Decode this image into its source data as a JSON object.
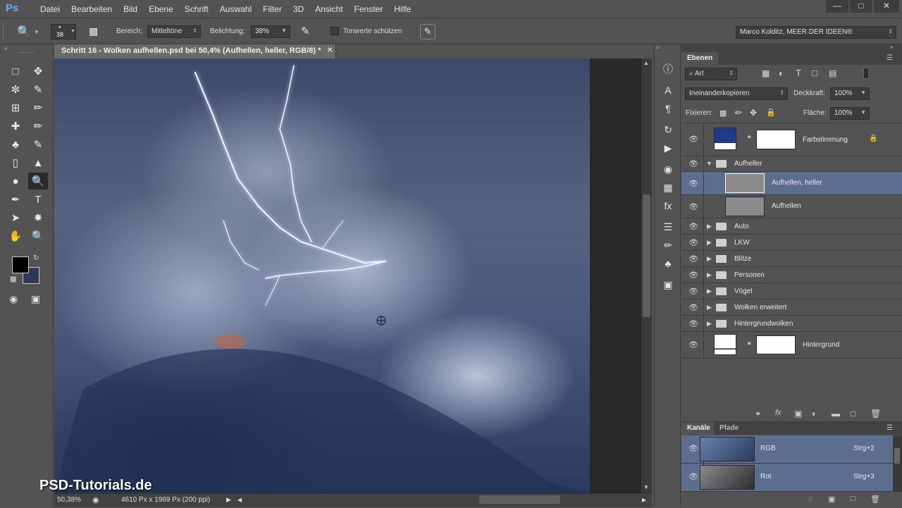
{
  "menubar": {
    "app_logo": "Ps",
    "items": [
      "Datei",
      "Bearbeiten",
      "Bild",
      "Ebene",
      "Schrift",
      "Auswahl",
      "Filter",
      "3D",
      "Ansicht",
      "Fenster",
      "Hilfe"
    ]
  },
  "optionsbar": {
    "brush_size": "38",
    "range_label": "Bereich:",
    "range_value": "Mitteltöne",
    "exposure_label": "Belichtung:",
    "exposure_value": "38%",
    "protect_tones_label": "Tonwerte schützen",
    "workspace": "Marco Kolditz, MEER DER IDEEN®"
  },
  "document": {
    "tab_title": "Schritt 16 - Wolken aufhellen.psd bei 50,4% (Aufhellen, heller, RGB/8) *",
    "zoom": "50,38%",
    "doc_info": "4610 Px x 1969 Px (200 ppi)",
    "watermark": "PSD-Tutorials.de"
  },
  "layers": {
    "panel_title": "Ebenen",
    "filter_kind": "Art",
    "blend_mode": "Ineinanderkopieren",
    "opacity_label": "Deckkraft:",
    "opacity_value": "100%",
    "lock_label": "Fixieren:",
    "fill_label": "Fläche:",
    "fill_value": "100%",
    "items": [
      {
        "name": "Farbstimmung"
      },
      {
        "name": "Aufheller"
      },
      {
        "name": "Aufhellen, heller"
      },
      {
        "name": "Aufhellen"
      },
      {
        "name": "Auto"
      },
      {
        "name": "LKW"
      },
      {
        "name": "Blitze"
      },
      {
        "name": "Personen"
      },
      {
        "name": "Vögel"
      },
      {
        "name": "Wolken erweitert"
      },
      {
        "name": "Hintergrundwolken"
      },
      {
        "name": "Hintergrund"
      }
    ]
  },
  "channels": {
    "tab_active": "Kanäle",
    "tab_inactive": "Pfade",
    "items": [
      {
        "name": "RGB",
        "shortcut": "Strg+2"
      },
      {
        "name": "Rot",
        "shortcut": "Strg+3"
      }
    ]
  },
  "colors": {
    "ui_bg": "#535353",
    "selected_row": "#5c6e8e",
    "farbstimmung_swatch": "#1e3b8a"
  }
}
